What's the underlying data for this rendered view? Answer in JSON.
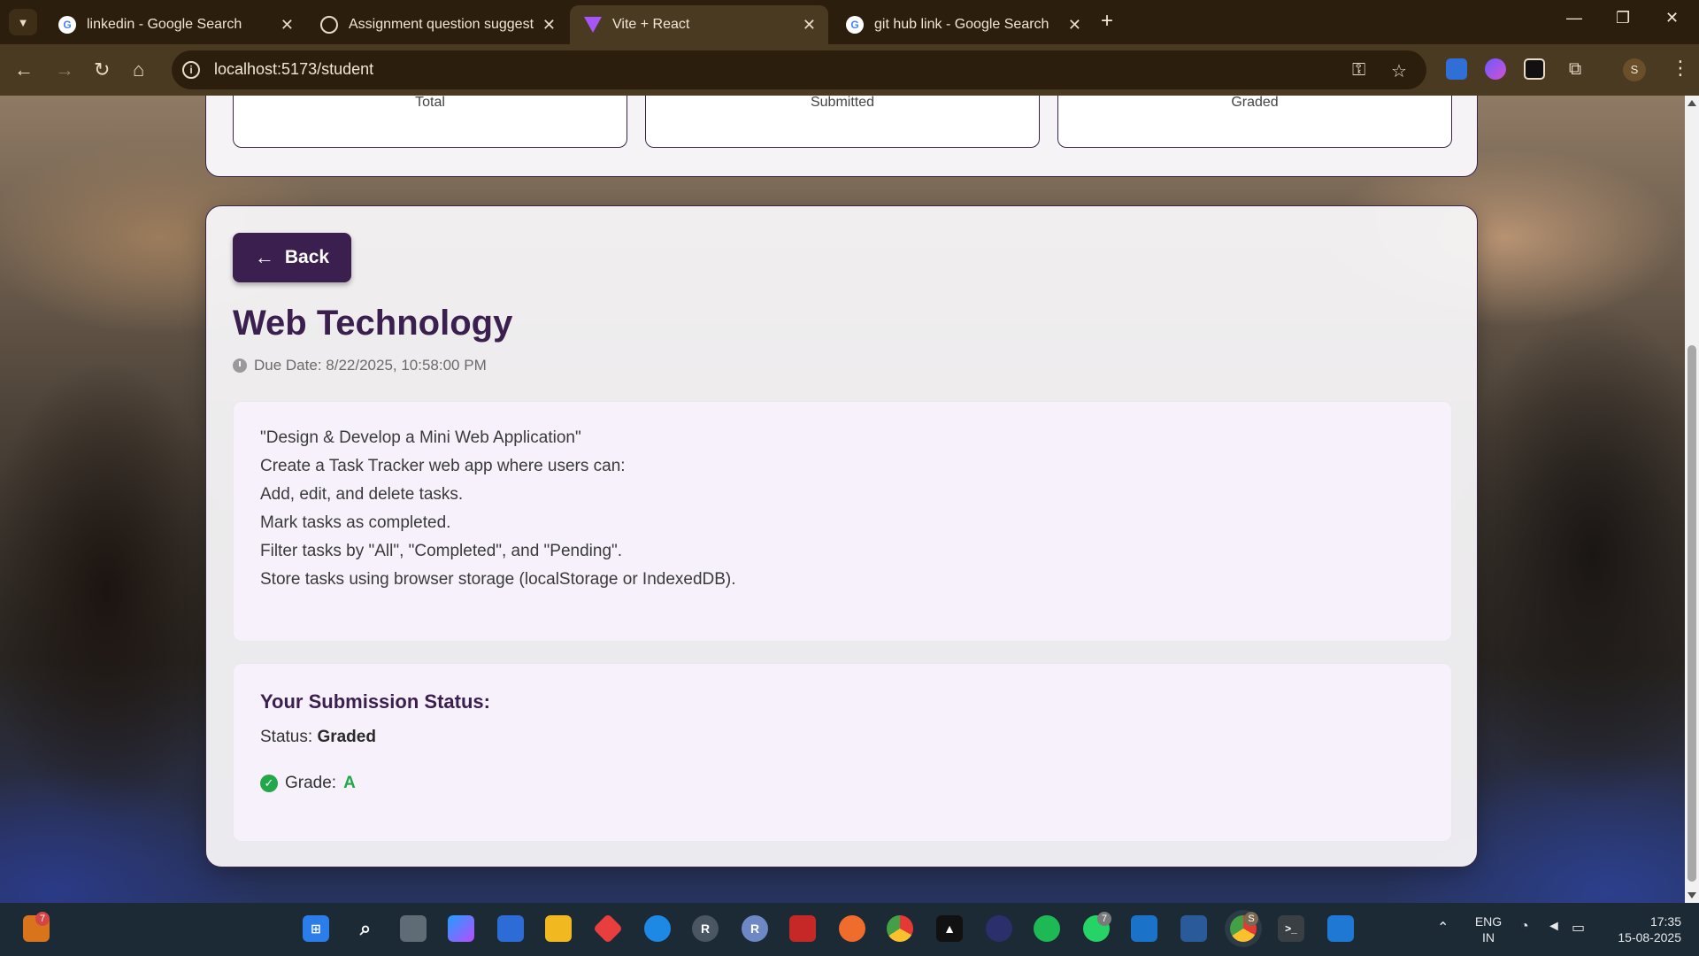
{
  "browser": {
    "tabs": [
      {
        "label": "linkedin - Google Search",
        "favicon": "google-icon",
        "active": false
      },
      {
        "label": "Assignment question suggestio",
        "favicon": "openai-icon",
        "active": false
      },
      {
        "label": "Vite + React",
        "favicon": "vite-icon",
        "active": true
      },
      {
        "label": "git hub link - Google Search",
        "favicon": "google-icon",
        "active": false
      }
    ],
    "url": "localhost:5173/student",
    "profile_initial": "S"
  },
  "stats": {
    "cards": [
      {
        "label": "Total"
      },
      {
        "label": "Submitted"
      },
      {
        "label": "Graded"
      }
    ]
  },
  "assignment": {
    "back_label": "Back",
    "title": "Web Technology",
    "due_date": "Due Date: 8/22/2025, 10:58:00 PM",
    "description_lines": [
      "\"Design & Develop a Mini Web Application\"",
      "Create a Task Tracker web app where users can:",
      "Add, edit, and delete tasks.",
      "Mark tasks as completed.",
      "Filter tasks by \"All\", \"Completed\", and \"Pending\".",
      "Store tasks using browser storage (localStorage or IndexedDB)."
    ]
  },
  "submission": {
    "heading": "Your Submission Status:",
    "status_label": "Status:",
    "status_value": "Graded",
    "grade_label": "Grade:",
    "grade_value": "A"
  },
  "taskbar": {
    "widget_badge": "7",
    "whatsapp_badge": "7",
    "chrome_badge": "S",
    "language": "ENG",
    "region": "IN",
    "time": "17:35",
    "date": "15-08-2025"
  },
  "colors": {
    "accent": "#3b1f4e",
    "grade_green": "#22a84a",
    "chrome_frame": "#4a3a22"
  }
}
